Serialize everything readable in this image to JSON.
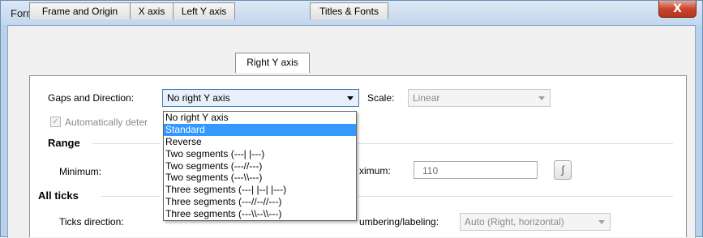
{
  "window": {
    "title": "Format Axes",
    "close_glyph": "X"
  },
  "tabs": [
    {
      "label": "Frame and Origin"
    },
    {
      "label": "X axis"
    },
    {
      "label": "Left Y axis"
    },
    {
      "label": "Right Y axis"
    },
    {
      "label": "Titles & Fonts"
    }
  ],
  "active_tab": "Right Y axis",
  "gaps": {
    "label": "Gaps and Direction:",
    "value": "No right Y axis",
    "options": [
      "No right Y axis",
      "Standard",
      "Reverse",
      "Two segments (---| |---)",
      "Two segments (---//---)",
      "Two segments (---\\\\---)",
      "Three segments (---| |--| |---)",
      "Three segments (---//--//---)",
      "Three segments (---\\\\--\\\\---)"
    ],
    "highlighted_option": "Standard"
  },
  "scale": {
    "label": "Scale:",
    "value": "Linear"
  },
  "auto_checkbox": {
    "label": "Automatically deter",
    "checked": true
  },
  "range": {
    "heading": "Range",
    "minimum_label": "Minimum:",
    "maximum_label": "ximum:",
    "maximum_value": "110"
  },
  "all_ticks": {
    "heading": "All ticks",
    "direction_label": "Ticks direction:",
    "numbering_label": "umbering/labeling:",
    "numbering_value": "Auto (Right, horizontal)"
  },
  "icons": {
    "close": "close-icon",
    "calc": "calculator-icon",
    "arrow": "chevron-down-icon"
  }
}
